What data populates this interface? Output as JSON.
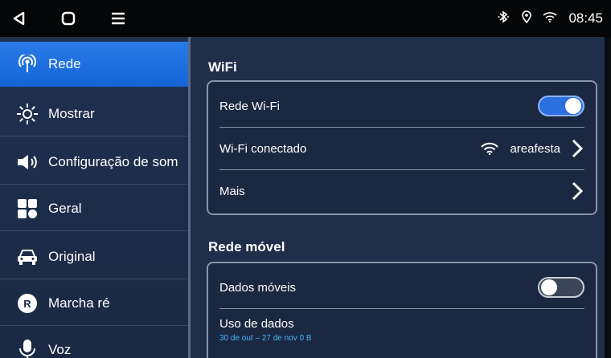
{
  "status_bar": {
    "clock": "08:45",
    "icons": [
      "back-icon",
      "home-icon",
      "menu-icon",
      "bluetooth-icon",
      "location-icon",
      "wifi-icon"
    ]
  },
  "sidebar": {
    "items": [
      {
        "label": "Rede",
        "icon": "antenna-icon",
        "active": true
      },
      {
        "label": "Mostrar",
        "icon": "brightness-icon",
        "active": false
      },
      {
        "label": "Configuração de som",
        "icon": "speaker-icon",
        "active": false
      },
      {
        "label": "Geral",
        "icon": "grid-icon",
        "active": false
      },
      {
        "label": "Original",
        "icon": "car-icon",
        "active": false
      },
      {
        "label": "Marcha ré",
        "icon": "reverse-icon",
        "active": false
      },
      {
        "label": "Voz",
        "icon": "microphone-icon",
        "active": false
      }
    ]
  },
  "wifi": {
    "title": "WiFi",
    "rows": [
      {
        "label": "Rede Wi-Fi",
        "toggle": "on"
      },
      {
        "label": "Wi-Fi conectado",
        "value": "areafesta"
      },
      {
        "label": "Mais"
      }
    ]
  },
  "mobile": {
    "title": "Rede móvel",
    "rows": [
      {
        "label": "Dados móveis",
        "toggle": "off"
      },
      {
        "label": "Uso de dados",
        "sub": "30 de out – 27 de nov 0 B"
      }
    ]
  },
  "colors": {
    "accent": "#1f6fe5",
    "background": "#1f2f4a",
    "data_usage_text": "#45b4ff"
  }
}
